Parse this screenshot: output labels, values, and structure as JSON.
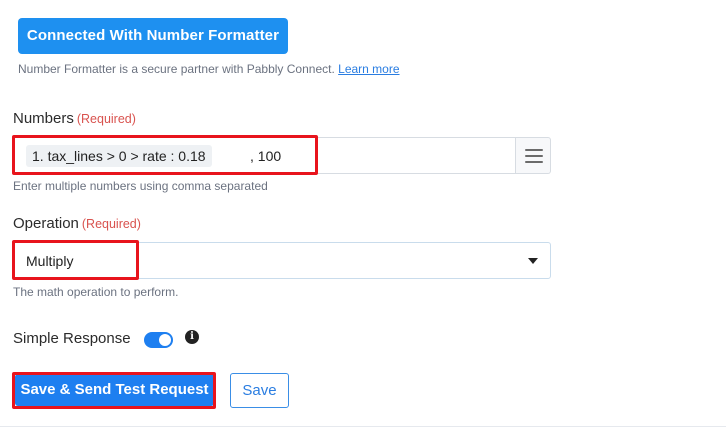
{
  "connection": {
    "button_label": "Connected With Number Formatter",
    "note": "Number Formatter is a secure partner with Pabbly Connect.",
    "learn_more": "Learn more"
  },
  "numbers": {
    "label": "Numbers",
    "required": "(Required)",
    "chip": "1. tax_lines > 0 > rate : 0.18",
    "rest": ", 100",
    "hint": "Enter multiple numbers using comma separated",
    "menu_icon": "hamburger-menu-icon"
  },
  "operation": {
    "label": "Operation",
    "required": "(Required)",
    "value": "Multiply",
    "hint": "The math operation to perform."
  },
  "simple_response": {
    "label": "Simple Response",
    "enabled": true,
    "info_icon": "info-icon"
  },
  "actions": {
    "primary_label": "Save & Send Test Request",
    "secondary_label": "Save"
  },
  "colors": {
    "accent": "#1e7ff0",
    "required": "#d9534f",
    "highlight": "#e8141c"
  }
}
